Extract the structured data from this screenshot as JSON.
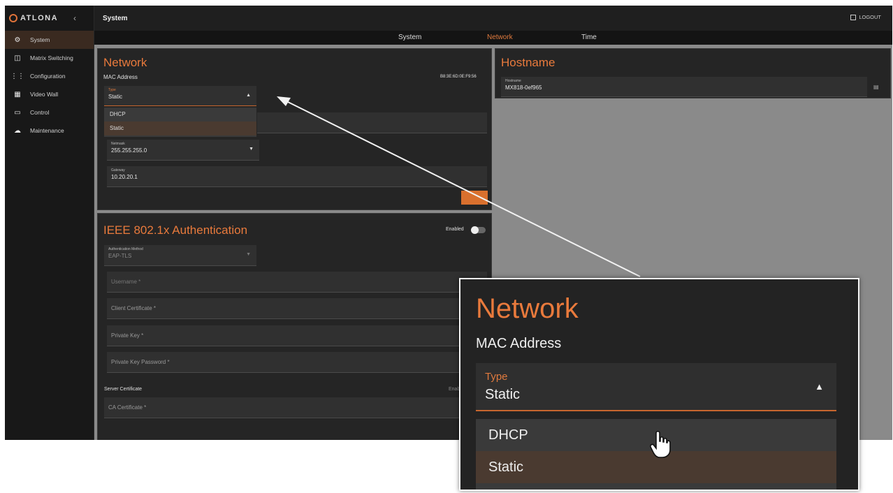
{
  "brand": {
    "name": "ATLONA"
  },
  "topbar": {
    "title": "System",
    "logout": "LOGOUT"
  },
  "sidebar": {
    "items": [
      {
        "label": "System",
        "icon": "gear-icon"
      },
      {
        "label": "Matrix Switching",
        "icon": "matrix-icon"
      },
      {
        "label": "Configuration",
        "icon": "sliders-icon"
      },
      {
        "label": "Video Wall",
        "icon": "grid-icon"
      },
      {
        "label": "Control",
        "icon": "monitor-icon"
      },
      {
        "label": "Maintenance",
        "icon": "cloud-icon"
      }
    ]
  },
  "tabs": [
    {
      "label": "System"
    },
    {
      "label": "Network"
    },
    {
      "label": "Time"
    }
  ],
  "network": {
    "title": "Network",
    "mac_label": "MAC Address",
    "mac_value": "B8:3E:6D:0E:F9:56",
    "type_label": "Type",
    "type_value": "Static",
    "options": [
      "DHCP",
      "Static"
    ],
    "netmask_label": "Netmask",
    "netmask_value": "255.255.255.0",
    "gateway_label": "Gateway",
    "gateway_value": "10.20.20.1"
  },
  "hostname": {
    "title": "Hostname",
    "field_label": "Hostname",
    "field_value": "MX818-0ef965"
  },
  "ieee": {
    "title": "IEEE 802.1x Authentication",
    "enabled_label": "Enabled",
    "auth_method_label": "Authentication Method",
    "auth_method_value": "EAP-TLS",
    "username_ph": "Username *",
    "client_cert_ph": "Client Certificate *",
    "private_key_ph": "Private Key *",
    "private_key_pw_ph": "Private Key Password *",
    "server_cert_label": "Server Certificate",
    "enable_fragment": "Enab",
    "ca_cert_ph": "CA Certificate *"
  },
  "zoom": {
    "title": "Network",
    "mac_label": "MAC Address",
    "type_label": "Type",
    "type_value": "Static",
    "options": [
      "DHCP",
      "Static"
    ]
  }
}
